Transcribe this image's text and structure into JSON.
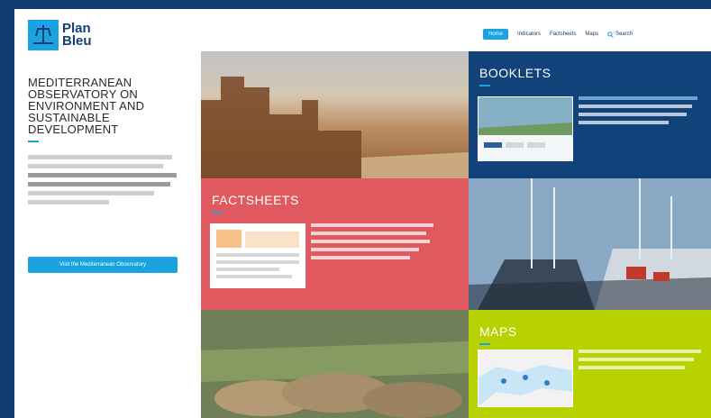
{
  "brand": {
    "line1": "Plan",
    "line2": "Bleu"
  },
  "nav": {
    "items": [
      "Home",
      "Indicators",
      "Factsheets",
      "Maps"
    ],
    "search": "Search"
  },
  "left_panel": {
    "title_lines": [
      "MEDITERRANEAN",
      "OBSERVATORY ON",
      "ENVIRONMENT AND",
      "SUSTAINABLE",
      "DEVELOPMENT"
    ],
    "cta_label": "Visit the Mediterranean Observatory"
  },
  "tiles": {
    "booklets": {
      "title": "BOOKLETS"
    },
    "factsheets": {
      "title": "FACTSHEETS"
    },
    "maps": {
      "title": "MAPS"
    }
  },
  "colors": {
    "navy": "#12427a",
    "accent": "#1aa3e0",
    "factsheets": "#e15a5f",
    "maps": "#b8d100"
  }
}
